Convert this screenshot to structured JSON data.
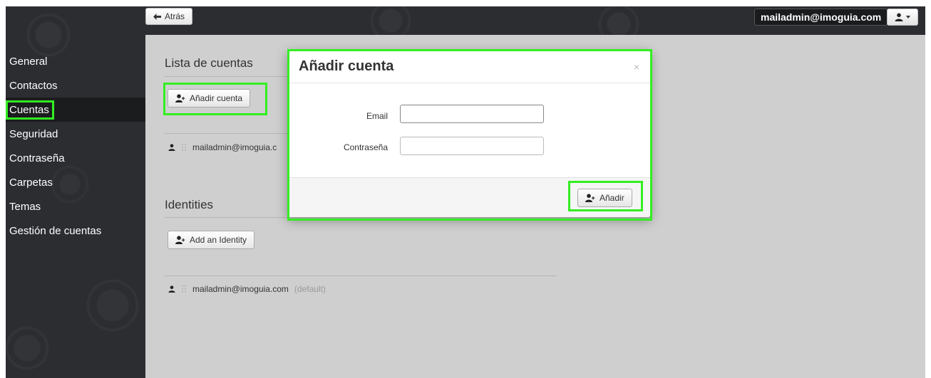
{
  "topbar": {
    "back_label": "Atrás",
    "user_email": "mailadmin@imoguia.com"
  },
  "sidebar": {
    "items": [
      {
        "label": "General"
      },
      {
        "label": "Contactos"
      },
      {
        "label": "Cuentas",
        "active": true
      },
      {
        "label": "Seguridad"
      },
      {
        "label": "Contraseña"
      },
      {
        "label": "Carpetas"
      },
      {
        "label": "Temas"
      },
      {
        "label": "Gestión de cuentas"
      }
    ]
  },
  "accounts": {
    "title": "Lista de cuentas",
    "add_button": "Añadir cuenta",
    "items": [
      {
        "email": "mailadmin@imoguia.c"
      }
    ]
  },
  "identities": {
    "title": "Identities",
    "add_button": "Add an Identity",
    "items": [
      {
        "email": "mailadmin@imoguia.com",
        "note": "(default)"
      }
    ]
  },
  "modal": {
    "title": "Añadir cuenta",
    "close_symbol": "×",
    "email_label": "Email",
    "email_value": "",
    "password_label": "Contraseña",
    "password_value": "",
    "submit_button": "Añadir"
  },
  "colors": {
    "highlight": "#33ee22",
    "sidebar_bg": "#2b2d31",
    "content_bg": "#cfcfcf"
  }
}
